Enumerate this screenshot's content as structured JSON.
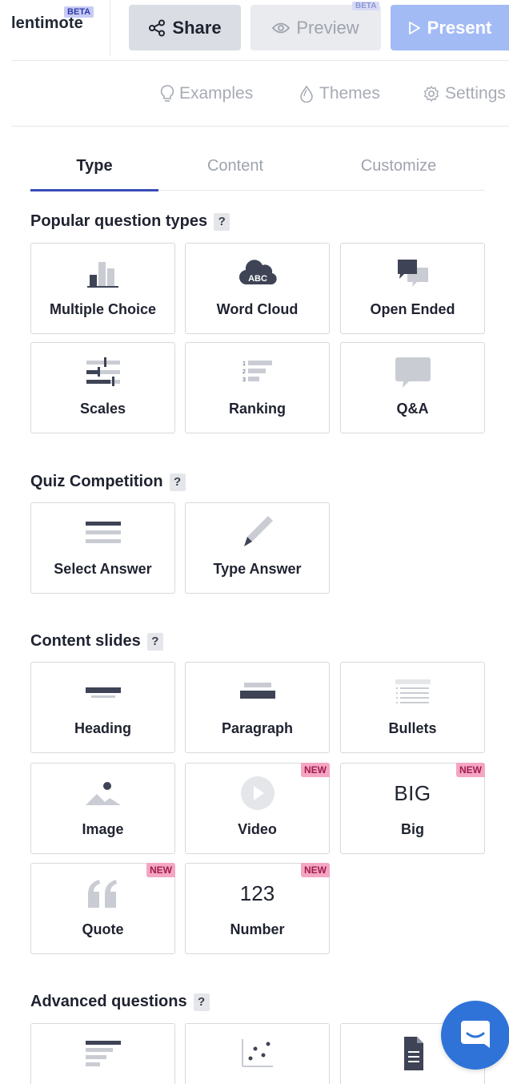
{
  "topbar": {
    "brand": "lentimote",
    "brand_badge": "BETA",
    "share_label": "Share",
    "preview_label": "Preview",
    "preview_badge": "BETA",
    "present_label": "Present"
  },
  "toolbar": {
    "examples_label": "Examples",
    "themes_label": "Themes",
    "settings_label": "Settings"
  },
  "tabs": [
    {
      "label": "Type",
      "active": true
    },
    {
      "label": "Content",
      "active": false
    },
    {
      "label": "Customize",
      "active": false
    }
  ],
  "sections": {
    "popular": {
      "title": "Popular question types",
      "help": "?",
      "items": [
        {
          "label": "Multiple Choice",
          "icon": "bar-chart-icon"
        },
        {
          "label": "Word Cloud",
          "icon": "word-cloud-icon",
          "icon_text": "ABC"
        },
        {
          "label": "Open Ended",
          "icon": "speech-bubbles-icon"
        },
        {
          "label": "Scales",
          "icon": "scales-icon"
        },
        {
          "label": "Ranking",
          "icon": "ranking-icon"
        },
        {
          "label": "Q&A",
          "icon": "qa-bubble-icon"
        }
      ]
    },
    "quiz": {
      "title": "Quiz Competition",
      "help": "?",
      "items": [
        {
          "label": "Select Answer",
          "icon": "list-lines-icon"
        },
        {
          "label": "Type Answer",
          "icon": "pencil-icon"
        }
      ]
    },
    "content": {
      "title": "Content slides",
      "help": "?",
      "items": [
        {
          "label": "Heading",
          "icon": "heading-icon"
        },
        {
          "label": "Paragraph",
          "icon": "paragraph-icon"
        },
        {
          "label": "Bullets",
          "icon": "bullets-icon"
        },
        {
          "label": "Image",
          "icon": "image-icon"
        },
        {
          "label": "Video",
          "icon": "play-icon",
          "badge": "NEW"
        },
        {
          "label": "Big",
          "icon": "big-text-icon",
          "icon_text": "BIG",
          "badge": "NEW"
        },
        {
          "label": "Quote",
          "icon": "quote-icon",
          "badge": "NEW"
        },
        {
          "label": "Number",
          "icon": "number-icon",
          "icon_text": "123",
          "badge": "NEW"
        }
      ]
    },
    "advanced": {
      "title": "Advanced questions",
      "help": "?",
      "items": [
        {
          "icon": "text-lines-icon"
        },
        {
          "icon": "scatter-icon"
        },
        {
          "icon": "document-icon"
        }
      ]
    }
  },
  "colors": {
    "accent": "#3a4bb8",
    "present_button": "#a3bbf5",
    "chat_button": "#2f73d9",
    "new_badge": "#f4a6c2",
    "icon_dark": "#3e4455",
    "icon_light": "#c9ccd3"
  }
}
